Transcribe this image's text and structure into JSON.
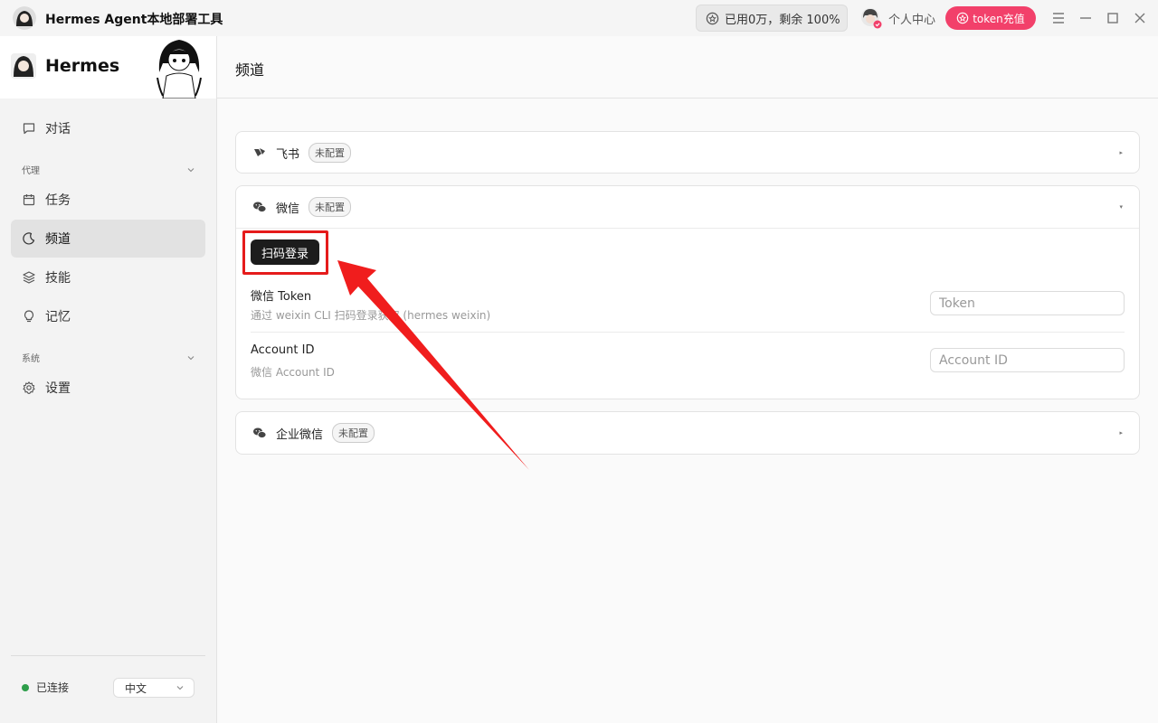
{
  "app": {
    "title": "Hermes Agent本地部署工具"
  },
  "usage": {
    "text": "已用0万，剩余 100%"
  },
  "user": {
    "center_label": "个人中心"
  },
  "recharge": {
    "label": "token充值"
  },
  "sidebar": {
    "brand": "Hermes",
    "chat": "对话",
    "section_agent": "代理",
    "tasks": "任务",
    "channels": "频道",
    "skills": "技能",
    "memory": "记忆",
    "section_system": "系统",
    "settings": "设置",
    "status": "已连接",
    "language": "中文"
  },
  "main": {
    "title": "频道"
  },
  "channels": {
    "feishu": {
      "name": "飞书",
      "badge": "未配置"
    },
    "wechat": {
      "name": "微信",
      "badge": "未配置",
      "scan_button": "扫码登录",
      "token_label": "微信 Token",
      "token_hint": "通过 weixin CLI 扫码登录获取 (hermes weixin)",
      "token_placeholder": "Token",
      "account_label": "Account ID",
      "account_hint": "微信 Account ID",
      "account_placeholder": "Account ID"
    },
    "wecom": {
      "name": "企业微信",
      "badge": "未配置"
    }
  },
  "colors": {
    "accent_recharge": "#f2406a",
    "highlight": "#e51b1b",
    "connected": "#2e9e4a"
  }
}
